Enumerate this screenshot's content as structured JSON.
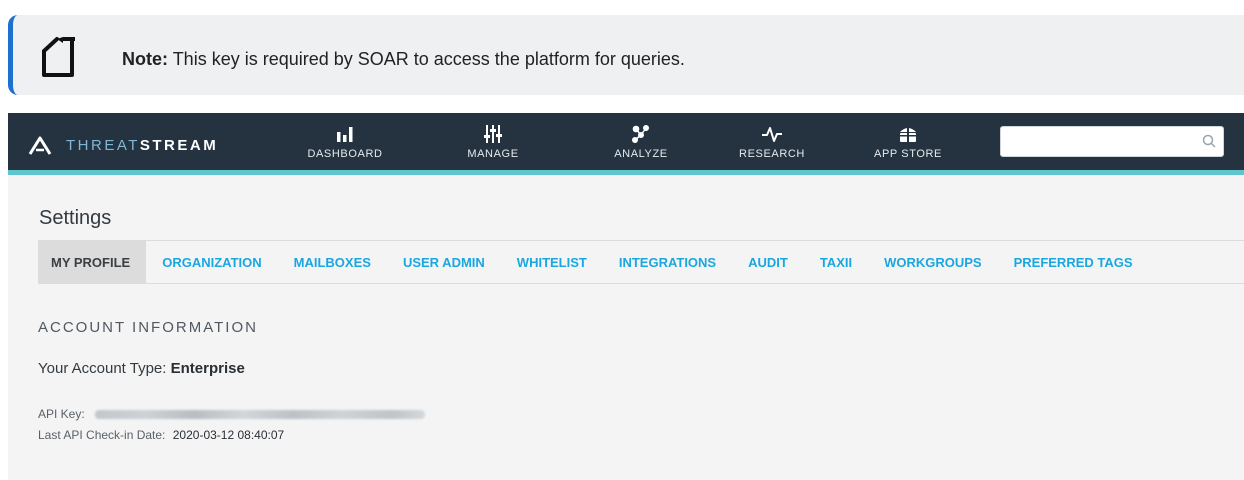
{
  "note": {
    "label": "Note:",
    "text": "This key is required by SOAR to access the platform for queries."
  },
  "brand": {
    "name_light": "THREAT",
    "name_bold": "STREAM"
  },
  "nav": {
    "items": [
      {
        "label": "DASHBOARD",
        "icon": "bar-chart-icon"
      },
      {
        "label": "MANAGE",
        "icon": "sliders-icon"
      },
      {
        "label": "ANALYZE",
        "icon": "molecule-icon"
      },
      {
        "label": "RESEARCH",
        "icon": "pulse-icon"
      },
      {
        "label": "APP STORE",
        "icon": "gift-icon"
      }
    ],
    "search_placeholder": ""
  },
  "settings": {
    "title": "Settings",
    "tabs": [
      {
        "label": "MY PROFILE",
        "active": true
      },
      {
        "label": "ORGANIZATION"
      },
      {
        "label": "MAILBOXES"
      },
      {
        "label": "USER ADMIN"
      },
      {
        "label": "WHITELIST"
      },
      {
        "label": "INTEGRATIONS"
      },
      {
        "label": "AUDIT"
      },
      {
        "label": "TAXII"
      },
      {
        "label": "WORKGROUPS"
      },
      {
        "label": "PREFERRED TAGS"
      }
    ]
  },
  "account": {
    "section_title": "ACCOUNT INFORMATION",
    "type_label": "Your Account Type:",
    "type_value": "Enterprise",
    "api_key_label": "API Key:",
    "checkin_label": "Last API Check-in Date:",
    "checkin_value": "2020-03-12 08:40:07"
  },
  "colors": {
    "note_accent": "#1f6fd1",
    "navbar_bg": "#25323f",
    "navbar_accent": "#5cc5cd",
    "tab_link": "#1aa7e0"
  }
}
